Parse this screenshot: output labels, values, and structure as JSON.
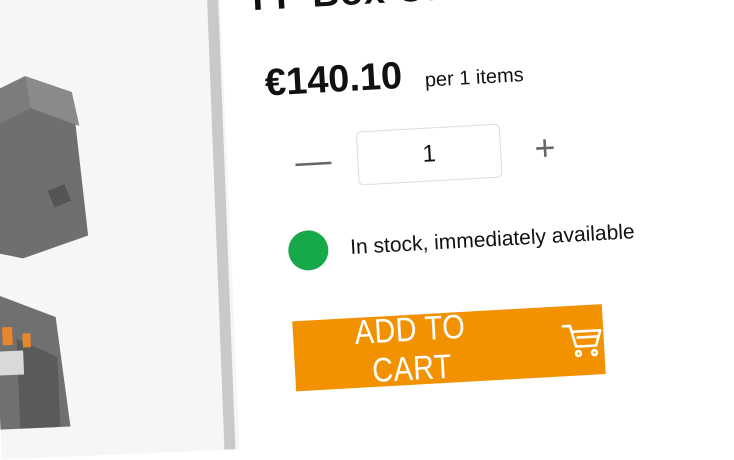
{
  "product": {
    "title": "FP Box ON/OFF",
    "title_suffix": "´",
    "price": "€140.10",
    "per_unit": "per 1 items"
  },
  "quantity": {
    "value": "1",
    "decrement_symbol": "—",
    "increment_symbol": "+"
  },
  "stock": {
    "text": "In stock, immediately available",
    "color": "#17a84a"
  },
  "cart": {
    "button_label": "ADD TO CART",
    "button_color": "#f39200",
    "icon": "cart-icon"
  }
}
